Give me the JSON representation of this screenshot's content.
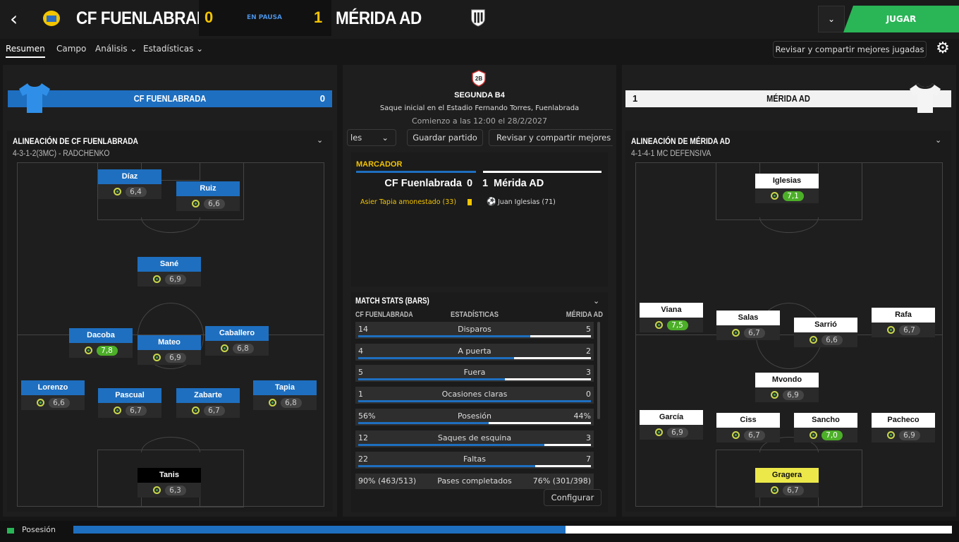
{
  "header": {
    "home_name": "CF FUENLABRADA",
    "away_name": "MÉRIDA AD",
    "home_score": "0",
    "away_score": "1",
    "status": "EN PAUSA",
    "play_label": "JUGAR",
    "dropdown": "⌄"
  },
  "tabs": [
    {
      "label": "Resumen"
    },
    {
      "label": "Campo"
    },
    {
      "label": "Análisis ⌄"
    },
    {
      "label": "Estadísticas ⌄"
    }
  ],
  "review_label": "Revisar y compartir mejores jugadas",
  "home_bar": {
    "name": "CF FUENLABRADA",
    "score": "0"
  },
  "away_bar": {
    "name": "MÉRIDA AD",
    "score": "1"
  },
  "match_info": {
    "competition": "SEGUNDA B4",
    "venue": "Saque inicial en el Estadio Fernando Torres, Fuenlabrada",
    "kickoff": "Comienzo a las 12:00 el 28/2/2027",
    "comp_badge": "2B"
  },
  "center_buttons": {
    "partial": "les",
    "save": "Guardar partido",
    "review": "Revisar y compartir mejores ju"
  },
  "scoreboard": {
    "title": "MARCADOR",
    "home": "CF Fuenlabrada",
    "home_score": "0",
    "away_score": "1",
    "away": "Mérida AD",
    "home_event": "Asier Tapia amonestado (33)",
    "away_event": "Juan Iglesias (71)"
  },
  "home_lineup": {
    "title": "ALINEACIÓN DE CF FUENLABRADA",
    "formation": "4-3-1-2(3MC) - RADCHENKO",
    "players": [
      {
        "name": "Díaz",
        "rating": "6,4",
        "good": false
      },
      {
        "name": "Ruiz",
        "rating": "6,6",
        "good": false
      },
      {
        "name": "Sané",
        "rating": "6,9",
        "good": false
      },
      {
        "name": "Dacoba",
        "rating": "7,8",
        "good": true
      },
      {
        "name": "Mateo",
        "rating": "6,9",
        "good": false
      },
      {
        "name": "Caballero",
        "rating": "6,8",
        "good": false
      },
      {
        "name": "Lorenzo",
        "rating": "6,6",
        "good": false
      },
      {
        "name": "Pascual",
        "rating": "6,7",
        "good": false
      },
      {
        "name": "Zabarte",
        "rating": "6,7",
        "good": false
      },
      {
        "name": "Tapia",
        "rating": "6,8",
        "good": false
      },
      {
        "name": "Tanis",
        "rating": "6,3",
        "good": false
      }
    ]
  },
  "away_lineup": {
    "title": "ALINEACIÓN DE MÉRIDA AD",
    "formation": "4-1-4-1 MC DEFENSIVA",
    "players": [
      {
        "name": "Iglesias",
        "rating": "7,1",
        "good": true
      },
      {
        "name": "Viana",
        "rating": "7,5",
        "good": true
      },
      {
        "name": "Salas",
        "rating": "6,7",
        "good": false
      },
      {
        "name": "Sarrió",
        "rating": "6,6",
        "good": false
      },
      {
        "name": "Rafa",
        "rating": "6,7",
        "good": false
      },
      {
        "name": "Mvondo",
        "rating": "6,9",
        "good": false
      },
      {
        "name": "García",
        "rating": "6,9",
        "good": false
      },
      {
        "name": "Ciss",
        "rating": "6,7",
        "good": false
      },
      {
        "name": "Sancho",
        "rating": "7,0",
        "good": true
      },
      {
        "name": "Pacheco",
        "rating": "6,9",
        "good": false
      },
      {
        "name": "Gragera",
        "rating": "6,7",
        "good": false
      }
    ]
  },
  "match_stats": {
    "title": "MATCH STATS (BARS)",
    "col_home": "CF FUENLABRADA",
    "col_mid": "ESTADÍSTICAS",
    "col_away": "MÉRIDA AD",
    "rows": [
      {
        "home": "14",
        "label": "Disparos",
        "away": "5",
        "home_share": 0.74
      },
      {
        "home": "4",
        "label": "A puerta",
        "away": "2",
        "home_share": 0.67
      },
      {
        "home": "5",
        "label": "Fuera",
        "away": "3",
        "home_share": 0.63
      },
      {
        "home": "1",
        "label": "Ocasiones claras",
        "away": "0",
        "home_share": 1.0
      },
      {
        "home": "56%",
        "label": "Posesión",
        "away": "44%",
        "home_share": 0.56
      },
      {
        "home": "12",
        "label": "Saques de esquina",
        "away": "3",
        "home_share": 0.8
      },
      {
        "home": "22",
        "label": "Faltas",
        "away": "7",
        "home_share": 0.76
      },
      {
        "home": "90% (463/513)",
        "label": "Pases completados",
        "away": "76% (301/398)"
      }
    ],
    "configure": "Configurar"
  },
  "footer": {
    "label": "Posesión",
    "home_possession": 0.56
  },
  "colors": {
    "home": "#1e6fc0",
    "away": "#ffffff",
    "accent_green": "#2ab557",
    "score_yellow": "#f3c400"
  }
}
